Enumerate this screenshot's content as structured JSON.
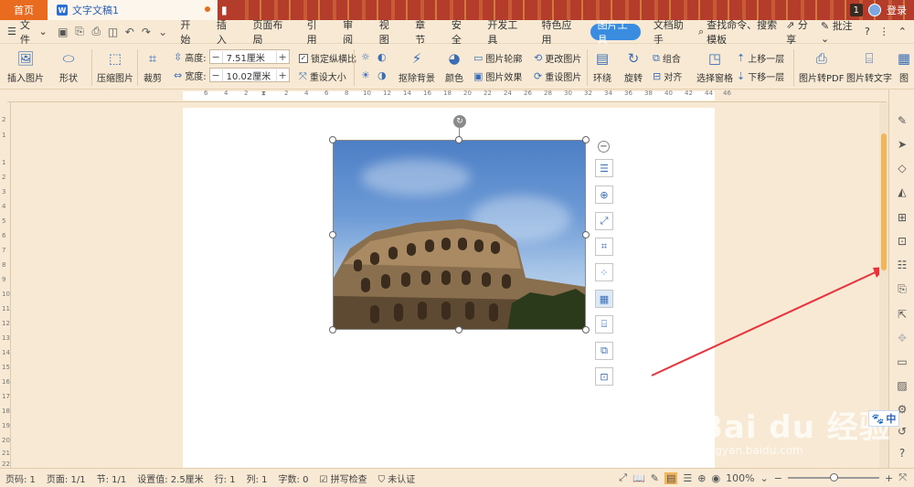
{
  "titlebar": {
    "home_tab": "首页",
    "doc_tab": "文字文稿1",
    "notice_count": "1",
    "user_name": "登录"
  },
  "menubar": {
    "file_label": "文件",
    "tabs": [
      "开始",
      "插入",
      "页面布局",
      "引用",
      "审阅",
      "视图",
      "章节",
      "安全",
      "开发工具",
      "特色应用",
      "图片工具",
      "文档助手"
    ],
    "active_tab": "图片工具",
    "search_label": "查找命令、搜索模板",
    "share_label": "分享",
    "comment_label": "批注",
    "help_label": "?"
  },
  "ribbon": {
    "insert_picture": "插入图片",
    "shape": "形状",
    "compress": "压缩图片",
    "crop": "裁剪",
    "height_label": "高度:",
    "height_value": "7.51厘米",
    "width_label": "宽度:",
    "width_value": "10.02厘米",
    "lock_ratio": "锁定纵横比",
    "reset_size": "重设大小",
    "remove_bg": "抠除背景",
    "color": "颜色",
    "outline": "图片轮廓",
    "effects": "图片效果",
    "change_pic": "更改图片",
    "reset_pic": "重设图片",
    "wrap": "环绕",
    "rotate": "旋转",
    "group": "组合",
    "align": "对齐",
    "select_pane": "选择窗格",
    "bring_forward": "上移一层",
    "send_backward": "下移一层",
    "to_pdf": "图片转PDF",
    "to_text": "图片转文字",
    "more": "图"
  },
  "ruler": {
    "h_marks": [
      "6",
      "4",
      "2",
      "2",
      "4",
      "6",
      "8",
      "10",
      "12",
      "14",
      "16",
      "18",
      "20",
      "22",
      "24",
      "26",
      "28",
      "30",
      "32",
      "34",
      "36",
      "38",
      "40",
      "42",
      "44",
      "46"
    ],
    "v_marks": [
      "2",
      "1",
      "1",
      "2",
      "3",
      "4",
      "5",
      "6",
      "7",
      "8",
      "9",
      "10",
      "11",
      "12",
      "13",
      "14",
      "15",
      "16",
      "17",
      "18",
      "19",
      "20",
      "21",
      "22"
    ]
  },
  "statusbar": {
    "page_code": "页码: 1",
    "pages": "页面: 1/1",
    "section": "节: 1/1",
    "setting": "设置值: 2.5厘米",
    "row": "行: 1",
    "col": "列: 1",
    "word_count": "字数: 0",
    "spell_check": "拼写检查",
    "auth": "未认证",
    "zoom": "100%"
  },
  "watermark": {
    "text": "Bai du 经验",
    "sub": "jingyan.baidu.com"
  },
  "ime": {
    "label": "中"
  },
  "colors": {
    "title_bg": "#b43c2b",
    "home_tab": "#e86b1f",
    "accent": "#3a8ce0",
    "ribbon_bg": "#f7e9d3",
    "arrow": "#e8323c"
  }
}
